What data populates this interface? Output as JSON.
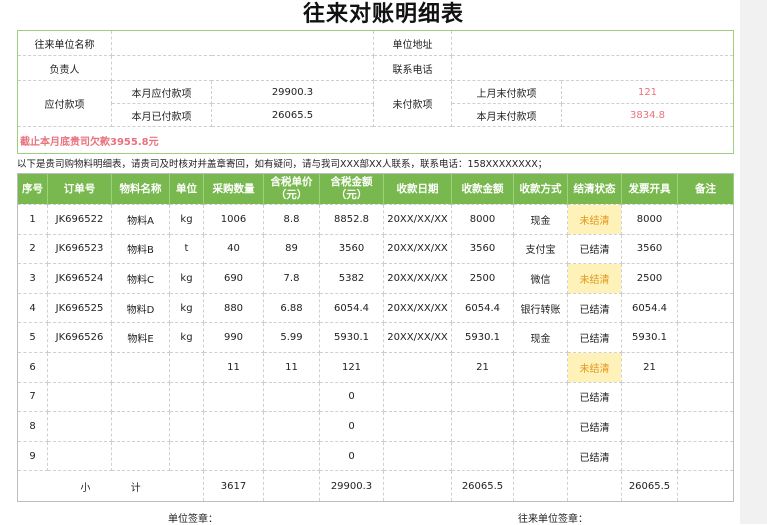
{
  "title": "往来对账明细表",
  "info": {
    "company_label": "往来单位名称",
    "company_value": "",
    "address_label": "单位地址",
    "address_value": "",
    "contact_label": "负责人",
    "contact_value": "",
    "phone_label": "联系电话",
    "phone_value": "",
    "payable_label": "应付款项",
    "payable_month_label": "本月应付款项",
    "payable_month_value": "29900.3",
    "paid_month_label": "本月已付款项",
    "paid_month_value": "26065.5",
    "unpaid_label": "未付款项",
    "last_month_unpaid_label": "上月末付款项",
    "last_month_unpaid_value": "121",
    "this_month_unpaid_label": "本月末付款项",
    "this_month_unpaid_value": "3834.8",
    "owe_text": "截止本月底贵司欠款3955.8元"
  },
  "note": "以下是贵司购物料明细表，请贵司及时核对并盖章寄回，如有疑问，请与我司XXX部XX人联系，联系电话：158XXXXXXXX；",
  "colors": {
    "header_green": "#79b84f",
    "unpaid_bg": "#fff2b8",
    "pink": "#e8737f"
  },
  "columns": [
    "序号",
    "订单号",
    "物料名称",
    "单位",
    "采购数量",
    "含税单价（元）",
    "含税金额（元）",
    "收款日期",
    "收款金额",
    "收款方式",
    "结清状态",
    "发票开具",
    "备注"
  ],
  "rows": [
    [
      "1",
      "JK696522",
      "物料A",
      "kg",
      "1006",
      "8.8",
      "8852.8",
      "20XX/XX/XX",
      "8000",
      "现金",
      "未结清",
      "8000",
      ""
    ],
    [
      "2",
      "JK696523",
      "物料B",
      "t",
      "40",
      "89",
      "3560",
      "20XX/XX/XX",
      "3560",
      "支付宝",
      "已结清",
      "3560",
      ""
    ],
    [
      "3",
      "JK696524",
      "物料C",
      "kg",
      "690",
      "7.8",
      "5382",
      "20XX/XX/XX",
      "2500",
      "微信",
      "未结清",
      "2500",
      ""
    ],
    [
      "4",
      "JK696525",
      "物料D",
      "kg",
      "880",
      "6.88",
      "6054.4",
      "20XX/XX/XX",
      "6054.4",
      "银行转账",
      "已结清",
      "6054.4",
      ""
    ],
    [
      "5",
      "JK696526",
      "物料E",
      "kg",
      "990",
      "5.99",
      "5930.1",
      "20XX/XX/XX",
      "5930.1",
      "现金",
      "已结清",
      "5930.1",
      ""
    ],
    [
      "6",
      "",
      "",
      "",
      "11",
      "11",
      "121",
      "",
      "21",
      "",
      "未结清",
      "21",
      ""
    ],
    [
      "7",
      "",
      "",
      "",
      "",
      "",
      "0",
      "",
      "",
      "",
      "已结清",
      "",
      ""
    ],
    [
      "8",
      "",
      "",
      "",
      "",
      "",
      "0",
      "",
      "",
      "",
      "已结清",
      "",
      ""
    ],
    [
      "9",
      "",
      "",
      "",
      "",
      "",
      "0",
      "",
      "",
      "",
      "已结清",
      "",
      ""
    ]
  ],
  "subtotal": {
    "label_1": "小",
    "label_2": "计",
    "qty": "3617",
    "amount": "29900.3",
    "received": "26065.5",
    "invoice": "26065.5"
  },
  "signature": {
    "ours": "单位签章：",
    "theirs": "往来单位签章："
  }
}
